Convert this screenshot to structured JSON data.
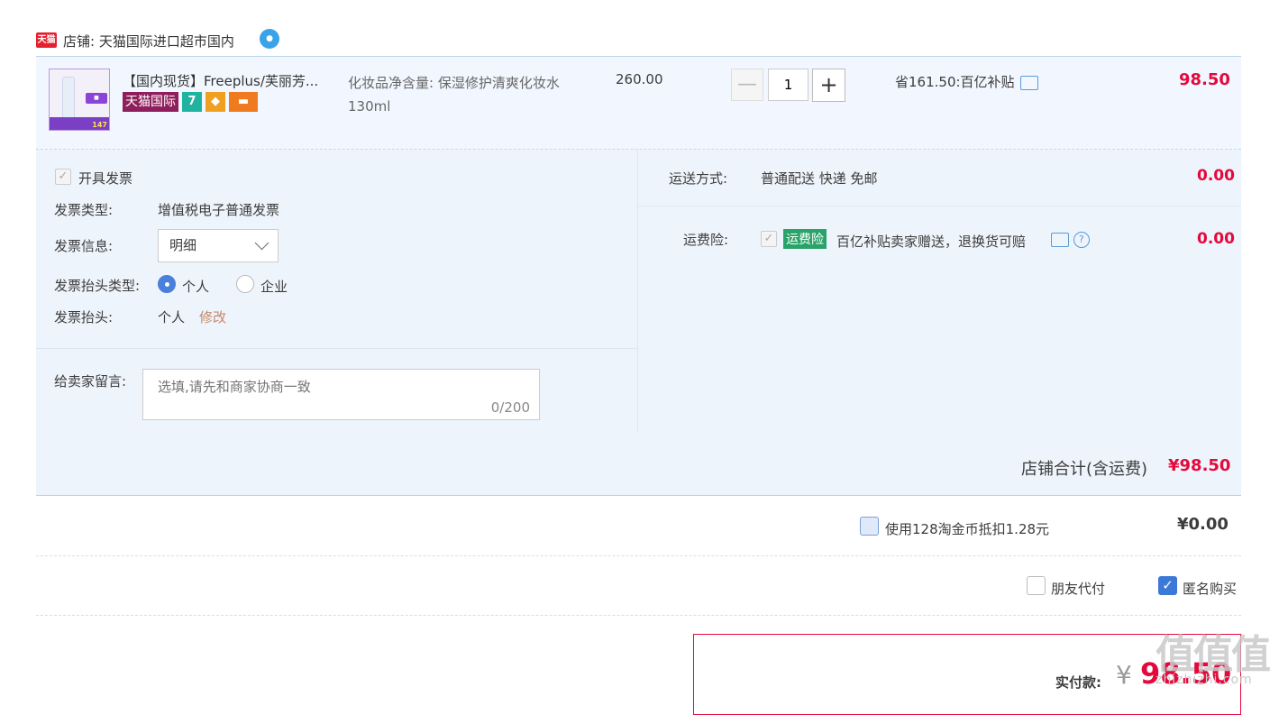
{
  "shop": {
    "logo_text": "天猫",
    "label": "店铺: 天猫国际进口超市国内"
  },
  "item": {
    "thumb_price": "147",
    "title": "【国内现货】Freeplus/芙丽芳...",
    "badge_tmall": "天猫国际",
    "badge_7": "7",
    "sku": "化妆品净含量: 保湿修护清爽化妆水130ml",
    "unit_price": "260.00",
    "qty_minus": "—",
    "quantity": "1",
    "qty_plus": "+",
    "saving": "省161.50:百亿补贴",
    "total": "98.50"
  },
  "invoice": {
    "open_label": "开具发票",
    "type_label": "发票类型:",
    "type_value": "增值税电子普通发票",
    "info_label": "发票信息:",
    "info_value": "明细",
    "title_type_label": "发票抬头类型:",
    "option_personal": "个人",
    "option_company": "企业",
    "title_label": "发票抬头:",
    "title_value": "个人",
    "edit_link": "修改"
  },
  "memo": {
    "label": "给卖家留言:",
    "placeholder": "选填,请先和商家协商一致",
    "count": "0/200"
  },
  "shipping": {
    "label": "运送方式:",
    "value": "普通配送 快递 免邮",
    "cost": "0.00"
  },
  "insurance": {
    "label": "运费险:",
    "badge": "运费险",
    "desc": "百亿补贴卖家赠送，退换货可赔",
    "help": "?",
    "cost": "0.00"
  },
  "store_total": {
    "label": "店铺合计(含运费)",
    "value": "¥98.50"
  },
  "coins": {
    "label": "使用128淘金币抵扣1.28元",
    "value": "¥0.00"
  },
  "options": {
    "friend_pay": "朋友代付",
    "anonymous": "匿名购买"
  },
  "payment": {
    "label": "实付款:",
    "currency": "¥",
    "amount": "98.50"
  },
  "watermark": {
    "mark": "值值值",
    "url": "zhizhizhi.com"
  },
  "colors": {
    "accent_red": "#e4093c",
    "panel_bg": "#eef4fb",
    "checkbox_blue": "#3b78d8",
    "insurance_green": "#2aa36a"
  }
}
